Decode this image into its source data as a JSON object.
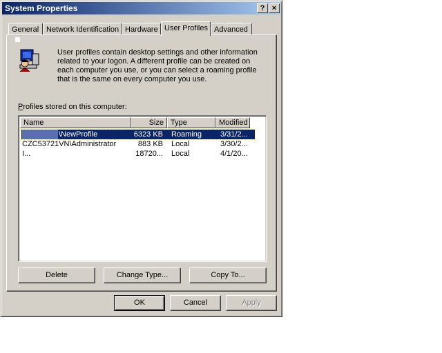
{
  "window": {
    "title": "System Properties",
    "help_button": "?",
    "close_button": "×"
  },
  "tabs": [
    {
      "label": "General"
    },
    {
      "label": "Network Identification"
    },
    {
      "label": "Hardware"
    },
    {
      "label": "User Profiles"
    },
    {
      "label": "Advanced"
    }
  ],
  "active_tab": "User Profiles",
  "description": "User profiles contain desktop settings and other information related to your logon.  A different profile can be created on each computer you use, or you can select a roaming profile that is the same on every computer you use.",
  "profiles_label": "Profiles stored on this computer:",
  "list": {
    "columns": [
      "Name",
      "Size",
      "Type",
      "Modified"
    ],
    "rows": [
      {
        "name": "\\NewProfile",
        "size": "6323 KB",
        "type": "Roaming",
        "modified": "3/31/2...",
        "selected": true
      },
      {
        "name": "CZC53721VN\\Administrator",
        "size": "883 KB",
        "type": "Local",
        "modified": "3/30/2...",
        "selected": false
      },
      {
        "name": "I...",
        "size": "18720...",
        "type": "Local",
        "modified": "4/1/20...",
        "selected": false
      }
    ]
  },
  "buttons": {
    "delete": "Delete",
    "change_type": "Change Type...",
    "copy_to": "Copy To...",
    "ok": "OK",
    "cancel": "Cancel",
    "apply": "Apply"
  },
  "colors": {
    "face": "#d4d0c8",
    "title_start": "#0a246a",
    "title_end": "#a6caf0",
    "selection": "#0a246a"
  }
}
